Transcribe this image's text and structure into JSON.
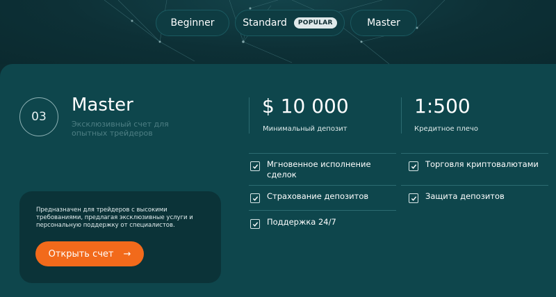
{
  "tabs": [
    {
      "label": "Beginner"
    },
    {
      "label": "Standard",
      "badge": "POPULAR"
    },
    {
      "label": "Master"
    }
  ],
  "plan": {
    "number": "03",
    "title": "Master",
    "subtitle": "Эксклюзивный счет для опытных трейдеров"
  },
  "stats": {
    "deposit_value": "$ 10 000",
    "deposit_label": "Минимальный депозит",
    "leverage_value": "1:500",
    "leverage_label": "Кредитное плечо"
  },
  "features_left": [
    "Мгновенное исполнение сделок",
    "Страхование депозитов",
    "Поддержка 24/7"
  ],
  "features_right": [
    "Торговля криптовалютами",
    "Защита депозитов"
  ],
  "description": "Предназначен для трейдеров с высокими требованиями, предлагая эксклюзивные услуги и персональную поддержку от специалистов.",
  "cta": {
    "label": "Открыть счет",
    "icon": "arrow-right-icon"
  },
  "colors": {
    "accent": "#f26a1b",
    "panel": "#0e464c",
    "background": "#0c2b30"
  }
}
